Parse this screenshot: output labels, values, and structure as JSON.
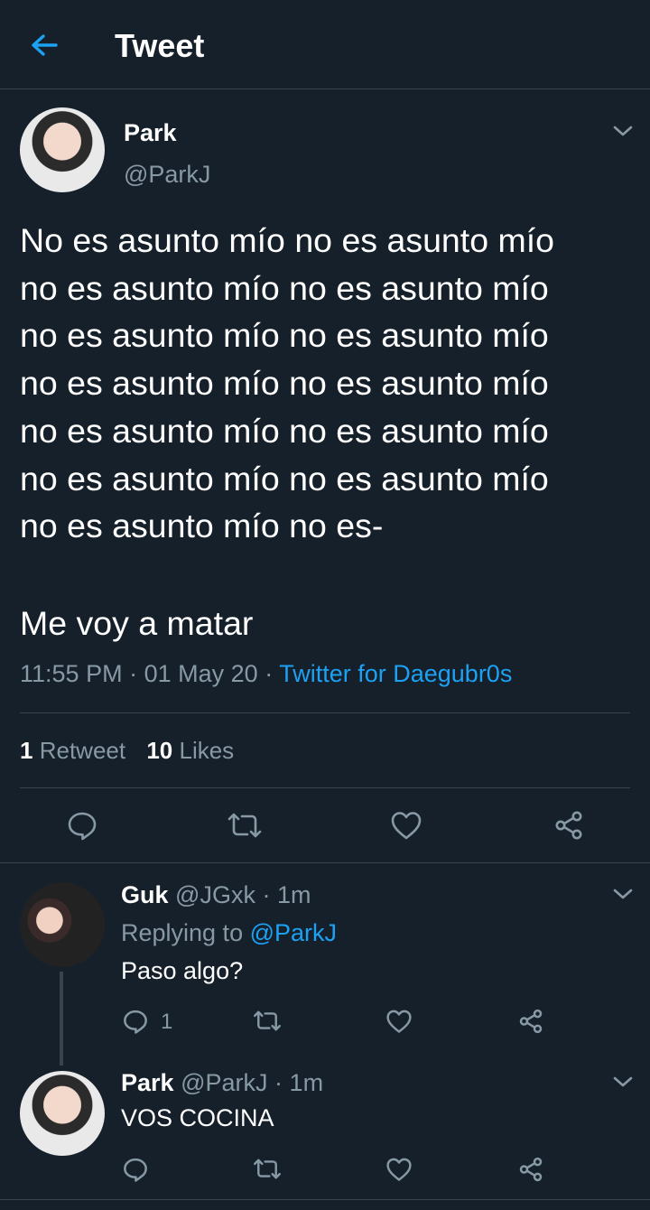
{
  "header": {
    "title": "Tweet"
  },
  "main_tweet": {
    "name": "Park",
    "handle": "@ParkJ",
    "body_lines": [
      "No es asunto mío no es asunto mío",
      "no es asunto mío no es asunto mío",
      "no es asunto mío no es asunto mío",
      "no es asunto mío no es asunto mío",
      "no es asunto mío no es asunto mío",
      "no es asunto mío no es asunto mío",
      "no es asunto mío no es-"
    ],
    "closing": "Me voy a matar",
    "time": "11:55 PM",
    "date": "01 May 20",
    "sep": "·",
    "source": "Twitter for Daegubr0s",
    "retweet_count": "1",
    "retweet_label": "Retweet",
    "like_count": "10",
    "like_label": "Likes"
  },
  "replies": [
    {
      "name": "Guk",
      "handle": "@JGxk",
      "sep": "·",
      "time": "1m",
      "replying_label": "Replying to",
      "replying_to": "@ParkJ",
      "text": "Paso algo?",
      "reply_count": "1"
    },
    {
      "name": "Park",
      "handle": "@ParkJ",
      "sep": "·",
      "time": "1m",
      "text": "VOS COCINA"
    }
  ],
  "colors": {
    "background": "#15202b",
    "accent": "#1da1f2",
    "muted": "#8899a6",
    "divider": "#38444d"
  },
  "icons": [
    "back-arrow-icon",
    "chevron-down-icon",
    "reply-icon",
    "retweet-icon",
    "like-icon",
    "share-icon"
  ]
}
